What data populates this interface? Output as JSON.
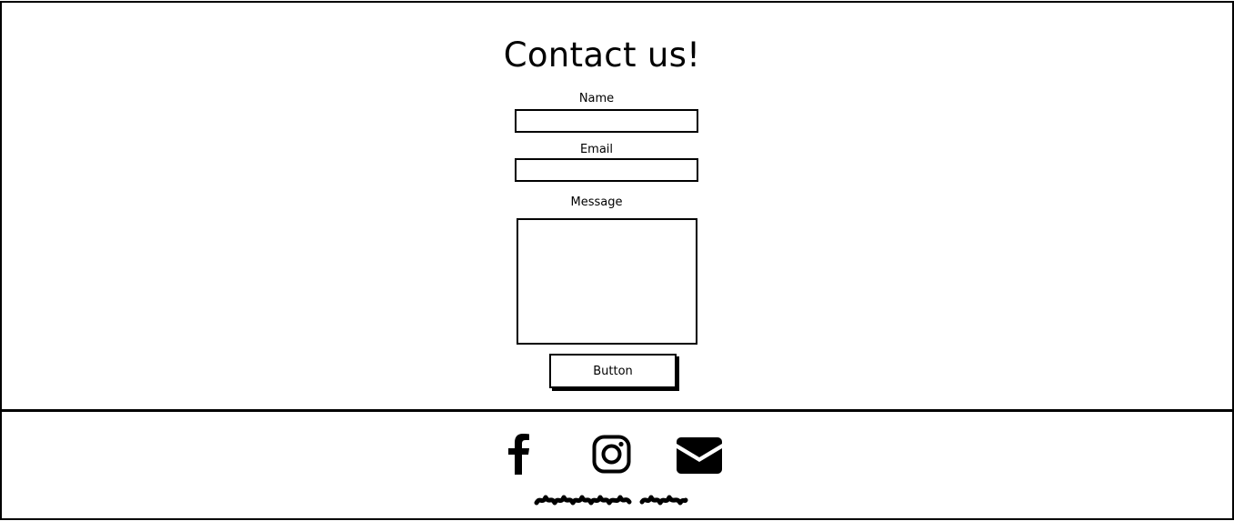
{
  "contact": {
    "title": "Contact us!",
    "name_label": "Name",
    "email_label": "Email",
    "message_label": "Message",
    "name_value": "",
    "email_value": "",
    "message_value": "",
    "submit_label": "Button"
  },
  "footer": {
    "icons": [
      "facebook-icon",
      "instagram-icon",
      "email-icon"
    ]
  }
}
